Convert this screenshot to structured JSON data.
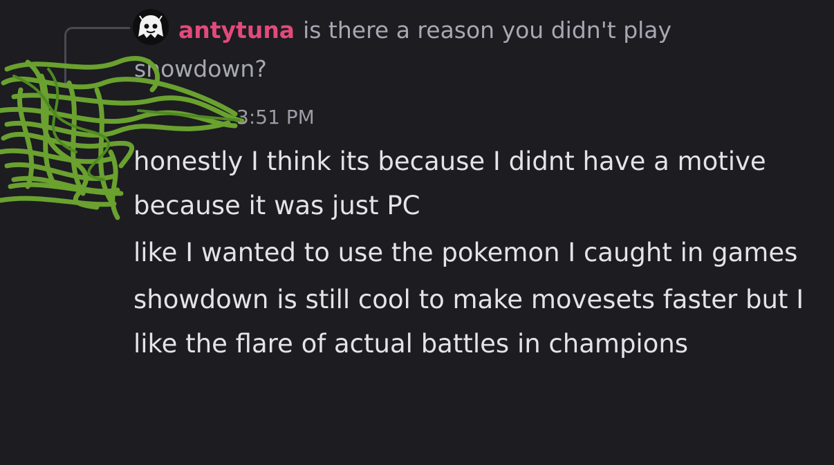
{
  "reply": {
    "author": "antytuna",
    "author_color": "#e24a7a",
    "text": "is there a reason you didn't play showdown?",
    "avatar_icon": "ghost-avatar-icon"
  },
  "message": {
    "author_redacted": true,
    "timestamp": "3:51 PM",
    "lines": [
      "honestly I think its because I didnt have a motive because it was just PC",
      "like I wanted to use the pokemon I caught in games",
      "showdown is still cool to make movesets faster but I like the flare of actual battles in champions"
    ]
  },
  "colors": {
    "background": "#1c1c21",
    "text": "#e3e3e8",
    "muted": "#a8a8b3",
    "scribble": "#6aa12f"
  }
}
